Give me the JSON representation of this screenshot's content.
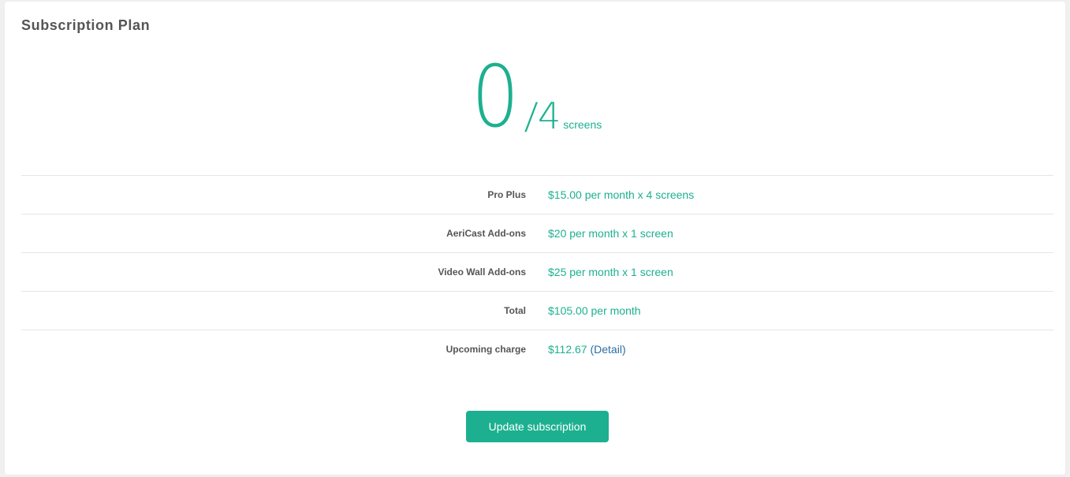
{
  "card": {
    "title": "Subscription Plan"
  },
  "usage": {
    "used": "0",
    "separator": "/",
    "total": "4",
    "unit": "screens"
  },
  "rows": [
    {
      "label": "Pro Plus",
      "value": "$15.00 per month x 4 screens"
    },
    {
      "label": "AeriCast Add-ons",
      "value": "$20 per month x 1 screen"
    },
    {
      "label": "Video Wall Add-ons",
      "value": "$25 per month x 1 screen"
    },
    {
      "label": "Total",
      "value": "$105.00 per month"
    },
    {
      "label": "Upcoming charge",
      "value": "$112.67",
      "link_open": "(",
      "link": "Detail",
      "link_close": ")"
    }
  ],
  "actions": {
    "update_label": "Update subscription"
  },
  "colors": {
    "accent": "#1cb090",
    "label": "#555555",
    "link": "#2a6ea6"
  }
}
